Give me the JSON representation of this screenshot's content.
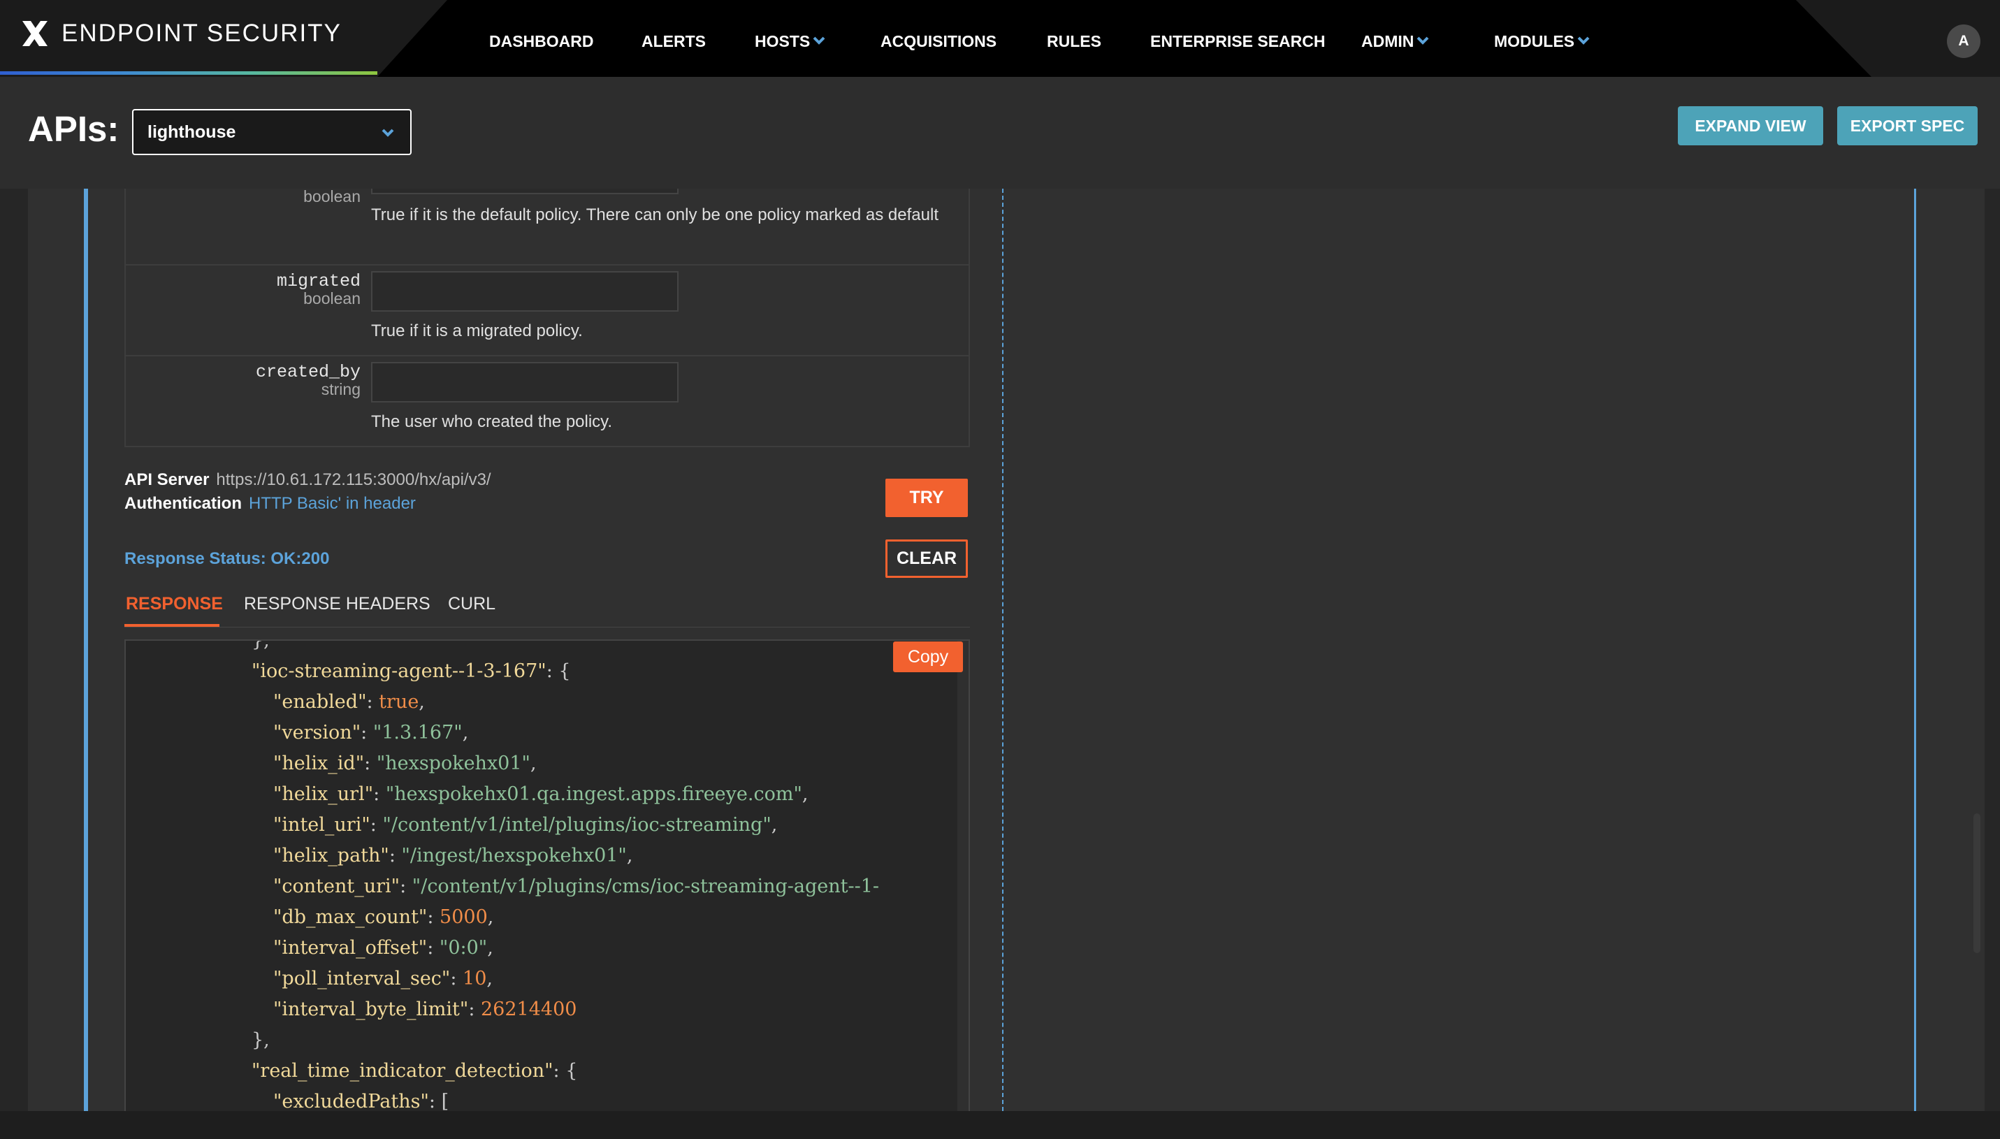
{
  "nav": {
    "app_title": "ENDPOINT SECURITY",
    "items": [
      "DASHBOARD",
      "ALERTS",
      "HOSTS",
      "ACQUISITIONS",
      "RULES",
      "ENTERPRISE SEARCH",
      "ADMIN",
      "MODULES"
    ],
    "avatar": "A"
  },
  "header": {
    "apis_label": "APIs:",
    "selected_api": "lighthouse",
    "expand_view": "EXPAND VIEW",
    "export_spec": "EXPORT SPEC"
  },
  "params": [
    {
      "name": "",
      "type": "boolean",
      "description": "True if it is the default policy. There can only be one policy marked as default"
    },
    {
      "name": "migrated",
      "type": "boolean",
      "description": "True if it is a migrated policy."
    },
    {
      "name": "created_by",
      "type": "string",
      "description": "The user who created the policy."
    }
  ],
  "request": {
    "api_server_label": "API Server",
    "api_server_value": "https://10.61.172.115:3000/hx/api/v3/",
    "auth_label": "Authentication",
    "auth_value": "HTTP Basic' in header",
    "try": "TRY",
    "clear": "CLEAR",
    "response_status": "Response Status: OK:200"
  },
  "tabs": [
    "RESPONSE",
    "RESPONSE HEADERS",
    "CURL"
  ],
  "copy": "Copy",
  "code": {
    "l0": "},",
    "l1_key": "\"ioc-streaming-agent--1-3-167\"",
    "l2_key": "\"enabled\"",
    "l2_val": "true",
    "l3_key": "\"version\"",
    "l3_val": "\"1.3.167\"",
    "l4_key": "\"helix_id\"",
    "l4_val": "\"hexspokehx01\"",
    "l5_key": "\"helix_url\"",
    "l5_val": "\"hexspokehx01.qa.ingest.apps.fireeye.com\"",
    "l6_key": "\"intel_uri\"",
    "l6_val": "\"/content/v1/intel/plugins/ioc-streaming\"",
    "l7_key": "\"helix_path\"",
    "l7_val": "\"/ingest/hexspokehx01\"",
    "l8_key": "\"content_uri\"",
    "l8_val": "\"/content/v1/plugins/cms/ioc-streaming-agent--1-",
    "l9_key": "\"db_max_count\"",
    "l9_val": "5000",
    "l10_key": "\"interval_offset\"",
    "l10_val": "\"0:0\"",
    "l11_key": "\"poll_interval_sec\"",
    "l11_val": "10",
    "l12_key": "\"interval_byte_limit\"",
    "l12_val": "26214400",
    "l13": "},",
    "l14_key": "\"real_time_indicator_detection\"",
    "l15_key": "\"excludedPaths\"",
    "l15_val": "["
  }
}
